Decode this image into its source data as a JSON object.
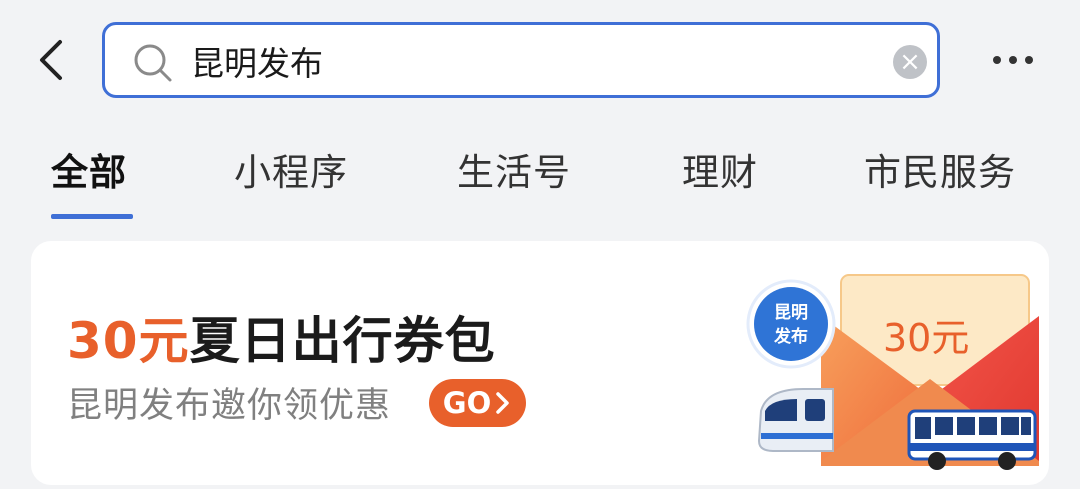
{
  "search": {
    "value": "昆明发布"
  },
  "tabs": [
    {
      "label": "全部",
      "active": true
    },
    {
      "label": "小程序"
    },
    {
      "label": "生活号"
    },
    {
      "label": "理财"
    },
    {
      "label": "市民服务"
    }
  ],
  "banner": {
    "title_highlight": "30元",
    "title_rest": "夏日出行券包",
    "subtitle": "昆明发布邀你领优惠",
    "go_label": "GO",
    "envelope_text": "30元",
    "badge_line1": "昆明",
    "badge_line2": "发布"
  },
  "colors": {
    "accent_blue": "#3f6fd6",
    "accent_orange": "#e8602b",
    "background": "#f2f3f5"
  },
  "icons": [
    "back-arrow-icon",
    "search-icon",
    "clear-icon",
    "more-icon",
    "chevron-right-icon"
  ]
}
